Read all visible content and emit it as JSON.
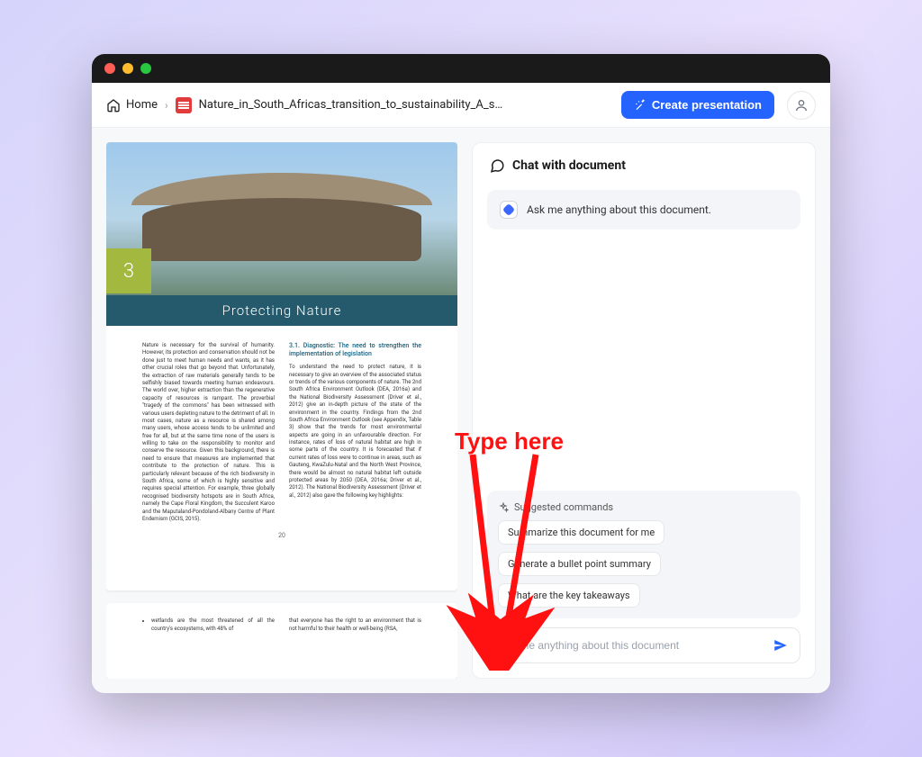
{
  "breadcrumb": {
    "home": "Home",
    "doc_title": "Nature_in_South_Africas_transition_to_sustainability_A_sto..."
  },
  "header": {
    "create_label": "Create presentation"
  },
  "document": {
    "chapter_number": "3",
    "chapter_title": "Protecting Nature",
    "page_number_bottom": "20",
    "col1_text": "Nature is necessary for the survival of humanity. However, its protection and conservation should not be done just to meet human needs and wants, as it has other crucial roles that go beyond that. Unfortunately, the extraction of raw materials generally tends to be selfishly biased towards meeting human endeavours. The world over, higher extraction than the regenerative capacity of resources is rampant. The proverbial \"tragedy of the commons\" has been witnessed with various users depleting nature to the detriment of all. In most cases, nature as a resource is shared among many users, whose access tends to be unlimited and free for all, but at the same time none of the users is willing to take on the responsibility to monitor and conserve the resource. Given this background, there is need to ensure that measures are implemented that contribute to the protection of nature. This is particularly relevant because of the rich biodiversity in South Africa, some of which is highly sensitive and requires special attention. For example, three globally recognised biodiversity hotspots are in South Africa, namely the Cape Floral Kingdom, the Succulent Karoo and the Maputaland-Pondoland-Albany Centre of Plant Endemism (GCIS, 2015).",
    "col2_heading": "3.1. Diagnostic: The need to strengthen the implementation of legislation",
    "col2_text": "To understand the need to protect nature, it is necessary to give an overview of the associated status or trends of the various components of nature. The 2nd South Africa Environment Outlook (DEA, 2016a) and the National Biodiversity Assessment (Driver et al., 2012) give an in-depth picture of the state of the environment in the country. Findings from the 2nd South Africa Environment Outlook (see Appendix, Table 3) show that the trends for most environmental aspects are going in an unfavourable direction. For instance, rates of loss of natural habitat are high in some parts of the country. It is forecasted that if current rates of loss were to continue in areas, such as Gauteng, KwaZulu-Natal and the North West Province, there would be almost no natural habitat left outside protected areas by 2050 (DEA, 2016a; Driver et al., 2012). The National Biodiversity Assessment (Driver et al., 2012) also gave the following key highlights:",
    "page2_bullet": "wetlands are the most threatened of all the country's ecosystems, with 48% of",
    "page2_col2": "that everyone has the right to an environment that is not harmful to their health or well-being (RSA,"
  },
  "chat": {
    "title": "Chat with document",
    "greeting": "Ask me anything about this document.",
    "suggested_label": "Suggested commands",
    "suggestions": [
      "Summarize this document for me",
      "Generate a bullet point summary",
      "What are the key takeaways"
    ],
    "input_placeholder": "Ask me anything about this document"
  },
  "annotation": {
    "text": "Type here"
  }
}
